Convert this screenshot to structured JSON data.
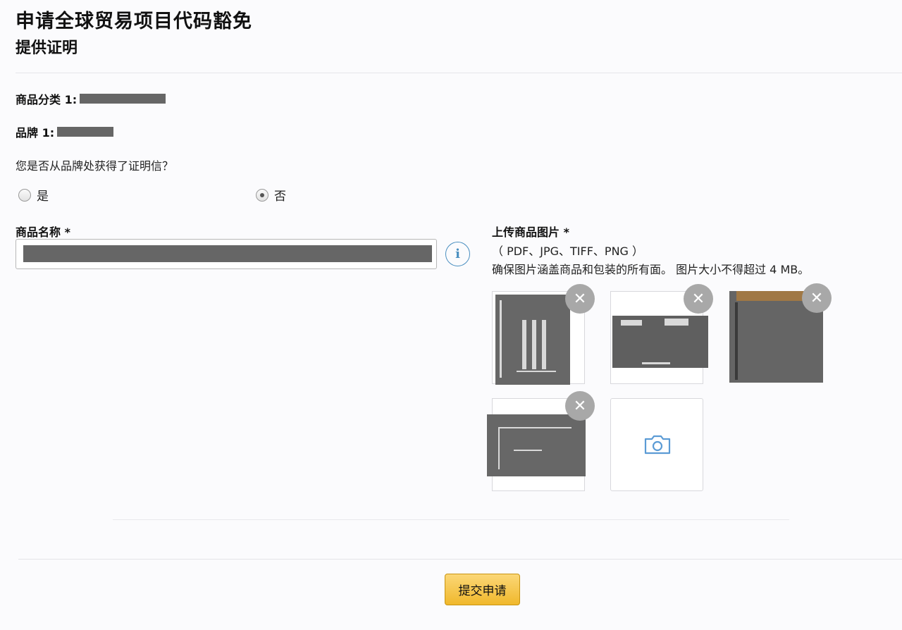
{
  "page": {
    "title": "申请全球贸易项目代码豁免",
    "subtitle": "提供证明"
  },
  "fields": {
    "category_label": "商品分类 1:",
    "brand_label": "品牌 1:"
  },
  "question": {
    "text": "您是否从品牌处获得了证明信？",
    "options": [
      {
        "label": "是",
        "selected": false
      },
      {
        "label": "否",
        "selected": true
      }
    ]
  },
  "product_name": {
    "label": "商品名称 *",
    "info_icon": "info-icon"
  },
  "upload": {
    "label": "上传商品图片 *",
    "formats": "（ PDF、JPG、TIFF、PNG ）",
    "note": "确保图片涵盖商品和包装的所有面。 图片大小不得超过 4 MB。",
    "add_icon": "camera-icon",
    "remove_icon": "close-icon",
    "image_count": 4
  },
  "actions": {
    "submit_label": "提交申请"
  },
  "colors": {
    "submit_bg": "#f0b82c",
    "info_accent": "#4a8fc0",
    "camera": "#5b9bd5"
  }
}
